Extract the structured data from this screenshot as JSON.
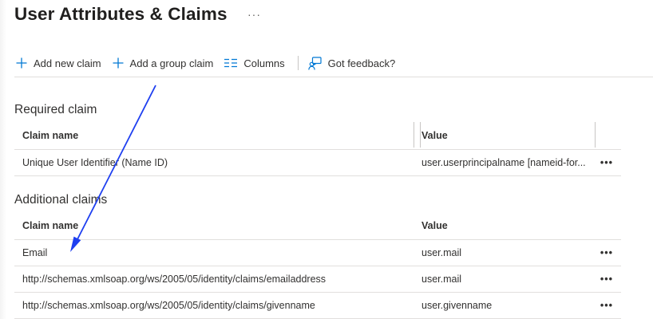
{
  "page": {
    "title": "User Attributes & Claims",
    "more_label": "···"
  },
  "toolbar": {
    "add_new_claim": "Add new claim",
    "add_group_claim": "Add a group claim",
    "columns": "Columns",
    "feedback": "Got feedback?"
  },
  "required": {
    "title": "Required claim",
    "headers": {
      "name": "Claim name",
      "value": "Value"
    },
    "rows": [
      {
        "name": "Unique User Identifier (Name ID)",
        "value": "user.userprincipalname [nameid-for...",
        "more": "•••"
      }
    ]
  },
  "additional": {
    "title": "Additional claims",
    "headers": {
      "name": "Claim name",
      "value": "Value"
    },
    "rows": [
      {
        "name": "Email",
        "value": "user.mail",
        "more": "•••"
      },
      {
        "name": "http://schemas.xmlsoap.org/ws/2005/05/identity/claims/emailaddress",
        "value": "user.mail",
        "more": "•••"
      },
      {
        "name": "http://schemas.xmlsoap.org/ws/2005/05/identity/claims/givenname",
        "value": "user.givenname",
        "more": "•••"
      }
    ]
  },
  "colors": {
    "accent": "#0078d4",
    "annotation_arrow": "#1e3ff0",
    "divider": "#e1dfdd"
  },
  "icons": {
    "add": "plus-icon",
    "columns": "columns-icon",
    "feedback": "feedback-icon",
    "more": "ellipsis-icon"
  }
}
